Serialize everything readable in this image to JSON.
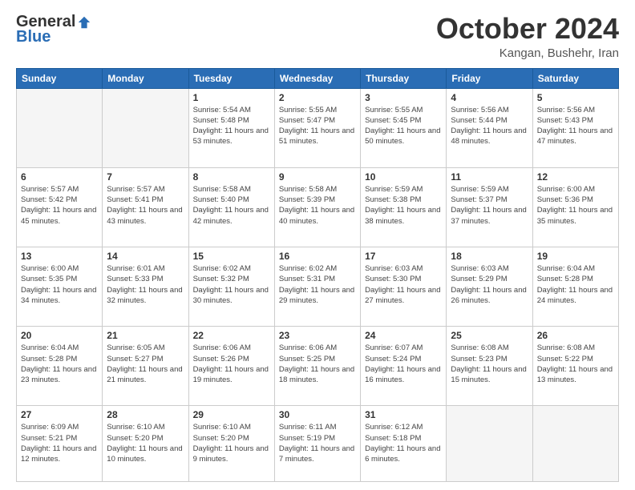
{
  "logo": {
    "general": "General",
    "blue": "Blue"
  },
  "header": {
    "month": "October 2024",
    "location": "Kangan, Bushehr, Iran"
  },
  "days_of_week": [
    "Sunday",
    "Monday",
    "Tuesday",
    "Wednesday",
    "Thursday",
    "Friday",
    "Saturday"
  ],
  "weeks": [
    [
      {
        "day": null
      },
      {
        "day": null
      },
      {
        "day": "1",
        "sunrise": "5:54 AM",
        "sunset": "5:48 PM",
        "daylight": "11 hours and 53 minutes."
      },
      {
        "day": "2",
        "sunrise": "5:55 AM",
        "sunset": "5:47 PM",
        "daylight": "11 hours and 51 minutes."
      },
      {
        "day": "3",
        "sunrise": "5:55 AM",
        "sunset": "5:45 PM",
        "daylight": "11 hours and 50 minutes."
      },
      {
        "day": "4",
        "sunrise": "5:56 AM",
        "sunset": "5:44 PM",
        "daylight": "11 hours and 48 minutes."
      },
      {
        "day": "5",
        "sunrise": "5:56 AM",
        "sunset": "5:43 PM",
        "daylight": "11 hours and 47 minutes."
      }
    ],
    [
      {
        "day": "6",
        "sunrise": "5:57 AM",
        "sunset": "5:42 PM",
        "daylight": "11 hours and 45 minutes."
      },
      {
        "day": "7",
        "sunrise": "5:57 AM",
        "sunset": "5:41 PM",
        "daylight": "11 hours and 43 minutes."
      },
      {
        "day": "8",
        "sunrise": "5:58 AM",
        "sunset": "5:40 PM",
        "daylight": "11 hours and 42 minutes."
      },
      {
        "day": "9",
        "sunrise": "5:58 AM",
        "sunset": "5:39 PM",
        "daylight": "11 hours and 40 minutes."
      },
      {
        "day": "10",
        "sunrise": "5:59 AM",
        "sunset": "5:38 PM",
        "daylight": "11 hours and 38 minutes."
      },
      {
        "day": "11",
        "sunrise": "5:59 AM",
        "sunset": "5:37 PM",
        "daylight": "11 hours and 37 minutes."
      },
      {
        "day": "12",
        "sunrise": "6:00 AM",
        "sunset": "5:36 PM",
        "daylight": "11 hours and 35 minutes."
      }
    ],
    [
      {
        "day": "13",
        "sunrise": "6:00 AM",
        "sunset": "5:35 PM",
        "daylight": "11 hours and 34 minutes."
      },
      {
        "day": "14",
        "sunrise": "6:01 AM",
        "sunset": "5:33 PM",
        "daylight": "11 hours and 32 minutes."
      },
      {
        "day": "15",
        "sunrise": "6:02 AM",
        "sunset": "5:32 PM",
        "daylight": "11 hours and 30 minutes."
      },
      {
        "day": "16",
        "sunrise": "6:02 AM",
        "sunset": "5:31 PM",
        "daylight": "11 hours and 29 minutes."
      },
      {
        "day": "17",
        "sunrise": "6:03 AM",
        "sunset": "5:30 PM",
        "daylight": "11 hours and 27 minutes."
      },
      {
        "day": "18",
        "sunrise": "6:03 AM",
        "sunset": "5:29 PM",
        "daylight": "11 hours and 26 minutes."
      },
      {
        "day": "19",
        "sunrise": "6:04 AM",
        "sunset": "5:28 PM",
        "daylight": "11 hours and 24 minutes."
      }
    ],
    [
      {
        "day": "20",
        "sunrise": "6:04 AM",
        "sunset": "5:28 PM",
        "daylight": "11 hours and 23 minutes."
      },
      {
        "day": "21",
        "sunrise": "6:05 AM",
        "sunset": "5:27 PM",
        "daylight": "11 hours and 21 minutes."
      },
      {
        "day": "22",
        "sunrise": "6:06 AM",
        "sunset": "5:26 PM",
        "daylight": "11 hours and 19 minutes."
      },
      {
        "day": "23",
        "sunrise": "6:06 AM",
        "sunset": "5:25 PM",
        "daylight": "11 hours and 18 minutes."
      },
      {
        "day": "24",
        "sunrise": "6:07 AM",
        "sunset": "5:24 PM",
        "daylight": "11 hours and 16 minutes."
      },
      {
        "day": "25",
        "sunrise": "6:08 AM",
        "sunset": "5:23 PM",
        "daylight": "11 hours and 15 minutes."
      },
      {
        "day": "26",
        "sunrise": "6:08 AM",
        "sunset": "5:22 PM",
        "daylight": "11 hours and 13 minutes."
      }
    ],
    [
      {
        "day": "27",
        "sunrise": "6:09 AM",
        "sunset": "5:21 PM",
        "daylight": "11 hours and 12 minutes."
      },
      {
        "day": "28",
        "sunrise": "6:10 AM",
        "sunset": "5:20 PM",
        "daylight": "11 hours and 10 minutes."
      },
      {
        "day": "29",
        "sunrise": "6:10 AM",
        "sunset": "5:20 PM",
        "daylight": "11 hours and 9 minutes."
      },
      {
        "day": "30",
        "sunrise": "6:11 AM",
        "sunset": "5:19 PM",
        "daylight": "11 hours and 7 minutes."
      },
      {
        "day": "31",
        "sunrise": "6:12 AM",
        "sunset": "5:18 PM",
        "daylight": "11 hours and 6 minutes."
      },
      {
        "day": null
      },
      {
        "day": null
      }
    ]
  ]
}
